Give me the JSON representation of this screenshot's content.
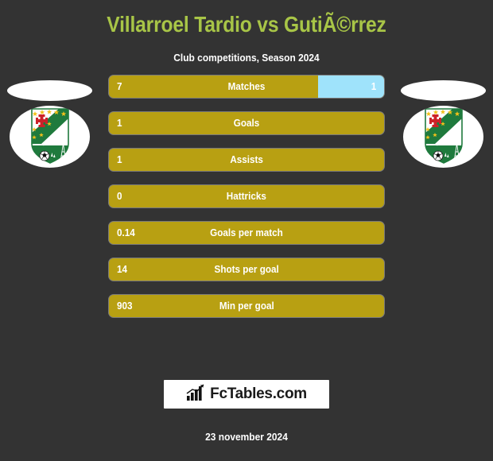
{
  "header": {
    "title": "Villarroel Tardio vs GutiÃ©rrez",
    "subtitle": "Club competitions, Season 2024"
  },
  "colors": {
    "background": "#333333",
    "title": "#a8c547",
    "home_bar": "#b8a012",
    "away_bar": "#9fe3fb",
    "text": "#ffffff"
  },
  "teams": {
    "home": {
      "crest_name": "oriente-petrolero-crest"
    },
    "away": {
      "crest_name": "oriente-petrolero-crest"
    }
  },
  "chart_data": {
    "type": "bar",
    "title": "Villarroel Tardio vs GutiÃ©rrez",
    "subtitle": "Club competitions, Season 2024",
    "categories": [
      "Matches",
      "Goals",
      "Assists",
      "Hattricks",
      "Goals per match",
      "Shots per goal",
      "Min per goal"
    ],
    "series": [
      {
        "name": "Villarroel Tardio",
        "values": [
          7,
          1,
          1,
          0,
          0.14,
          14,
          903
        ]
      },
      {
        "name": "GutiÃ©rrez",
        "values": [
          1,
          null,
          null,
          null,
          null,
          null,
          null
        ]
      }
    ],
    "legend": "none",
    "grid": false
  },
  "stats": [
    {
      "label": "Matches",
      "home": "7",
      "away": "1",
      "away_fill_pct": 24
    },
    {
      "label": "Goals",
      "home": "1",
      "away": "",
      "away_fill_pct": 0
    },
    {
      "label": "Assists",
      "home": "1",
      "away": "",
      "away_fill_pct": 0
    },
    {
      "label": "Hattricks",
      "home": "0",
      "away": "",
      "away_fill_pct": 0
    },
    {
      "label": "Goals per match",
      "home": "0.14",
      "away": "",
      "away_fill_pct": 0
    },
    {
      "label": "Shots per goal",
      "home": "14",
      "away": "",
      "away_fill_pct": 0
    },
    {
      "label": "Min per goal",
      "home": "903",
      "away": "",
      "away_fill_pct": 0
    }
  ],
  "footer": {
    "brand_name": "FcTables.com",
    "brand_icon": "bar-chart-icon",
    "date": "23 november 2024"
  }
}
